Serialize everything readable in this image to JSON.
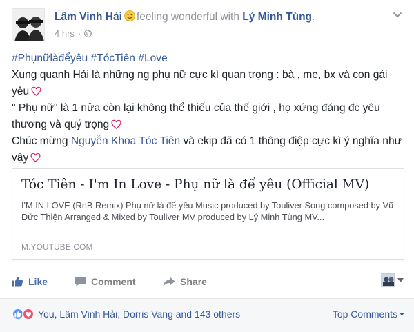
{
  "post": {
    "author": "Lâm Vinh Hải",
    "feeling_text": "feeling wonderful with",
    "tagged": "Lý Minh Tùng",
    "tagged_suffix": ".",
    "time": "4 hrs",
    "time_separator": "·",
    "feeling_icon": "smiley-emoji-icon",
    "privacy_icon": "globe-icon",
    "menu_icon": "chevron-down-icon"
  },
  "body": {
    "hashtags": [
      "#Phụnữlàđểyêu",
      "#TócTiên",
      "#Love"
    ],
    "line2": "Xung quanh Hải là những ng phụ nữ cực kì quan trọng : bà , mẹ, bx và con gái yêu",
    "line3": "\" Phụ nữ\" là 1 nửa còn lại không thể thiếu của thế giới , họ xứng đáng đc yêu thương và quý trọng",
    "line4_prefix": "Chúc mừng",
    "line4_mention": "Nguyễn Khoa Tóc Tiên",
    "line4_suffix": "và ekip đã có 1 thông điệp cực kì ý nghĩa như vậy",
    "heart_icon": "heart-emoji-icon"
  },
  "link_card": {
    "title": "Tóc Tiên - I'm In Love - Phụ nữ là để yêu (Official MV)",
    "description": "I'M IN LOVE (RnB Remix) Phụ nữ là để yêu Music produced by Touliver Song composed by Vũ Đức Thiện Arranged & Mixed by Touliver MV produced by Lý Minh Tùng MV...",
    "domain": "M.YOUTUBE.COM"
  },
  "actions": {
    "like": "Like",
    "comment": "Comment",
    "share": "Share",
    "like_icon": "thumbs-up-icon",
    "comment_icon": "comment-icon",
    "share_icon": "share-arrow-icon"
  },
  "footer": {
    "reactions_text": "You, Lâm Vinh Hải, Dorris Vang and 143 others",
    "top_comments": "Top Comments",
    "colors": {
      "link": "#365899",
      "like": "#5890ff",
      "love": "#f25268"
    }
  }
}
